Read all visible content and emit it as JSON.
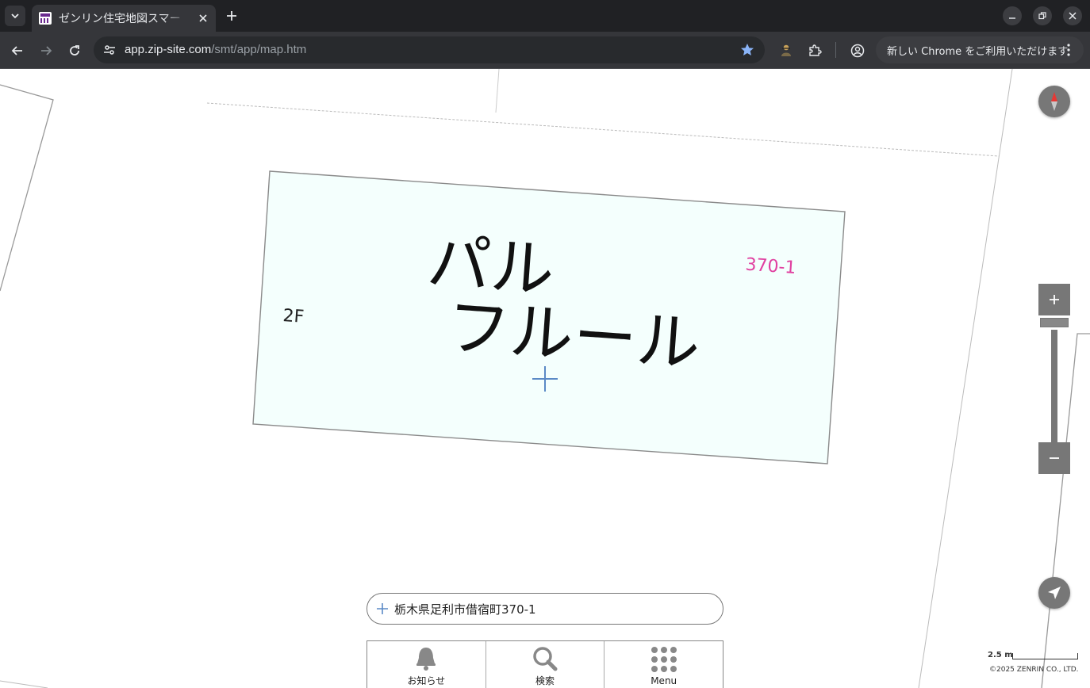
{
  "browser": {
    "tab": {
      "title": "ゼンリン住宅地図スマー",
      "favicon": "zenrin-favicon"
    },
    "url": {
      "host": "app.zip-site.com",
      "path": "/smt/app/map.htm"
    },
    "update_notice": "新しい Chrome をご利用いただけます",
    "icons": [
      "tab-search-icon",
      "close-icon",
      "plus-icon",
      "minimize-icon",
      "restore-icon",
      "back-icon",
      "forward-icon",
      "reload-icon",
      "site-settings-icon",
      "star-icon",
      "extension-icon",
      "puzzle-icon",
      "profile-icon",
      "more-icon"
    ]
  },
  "map": {
    "building": {
      "name_line1": "パル",
      "name_line2": "フルール",
      "floors": "2F",
      "lot_number": "370-1"
    },
    "address": "栃木県足利市借宿町370-1",
    "nav": [
      {
        "label": "お知らせ",
        "icon": "bell-icon"
      },
      {
        "label": "検索",
        "icon": "search-icon"
      },
      {
        "label": "Menu",
        "icon": "grid-dots-icon"
      }
    ],
    "scale_label": "2.5 m",
    "copyright": "©2025 ZENRIN CO., LTD.",
    "colors": {
      "building_fill": "#f4fffd",
      "lot_number": "#e040a0",
      "controls": "#777777",
      "crosshair": "#5b8ac6"
    }
  }
}
